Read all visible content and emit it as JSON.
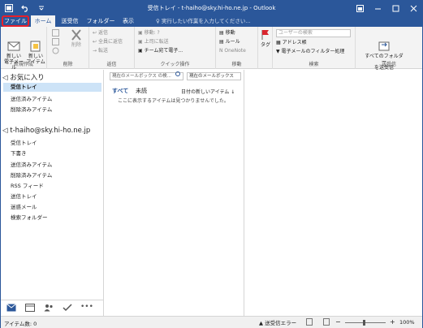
{
  "window": {
    "title": "受信トレイ - t-haiho@sky.hi-ho.ne.jp - Outlook",
    "qat": [
      "outlook-icon",
      "undo-icon",
      "customize-icon"
    ],
    "buttons": [
      "restore-icon",
      "minimize-icon",
      "maximize-icon",
      "close-icon"
    ]
  },
  "tabs": [
    {
      "label": "ファイル"
    },
    {
      "label": "ホーム"
    },
    {
      "label": "送受信"
    },
    {
      "label": "フォルダー"
    },
    {
      "label": "表示"
    }
  ],
  "tell_me": "♀ 実行したい作業を入力してください...",
  "ribbon": {
    "new": {
      "new_email": "新しい\n電子メール",
      "new_items": "新しい\nアイテム",
      "label": "新規作成"
    },
    "delete": {
      "delete": "削除",
      "label": "削除"
    },
    "respond": {
      "reply": "返信",
      "reply_all": "全員に返信",
      "forward": "転送",
      "label": "返信"
    },
    "quick_steps": {
      "move_to": "移動: ?",
      "to_manager": "上司に転送",
      "team_email": "チーム宛て電子...",
      "label": "クイック操作"
    },
    "move": {
      "move": "移動",
      "rules": "ルール",
      "onenote": "OneNote",
      "label": "移動"
    },
    "tags": {
      "tags": "タグ"
    },
    "find": {
      "search_people": "ユーザーの検索",
      "address_book": "アドレス帳",
      "filter_email": "電子メールのフィルター処理",
      "label": "検索"
    },
    "send_receive": {
      "send_all": "すべてのフォルダー\nを送受信",
      "label": "送受信"
    }
  },
  "folders": {
    "favorites_header": "◁ お気に入り",
    "favorites": [
      "受信トレイ",
      "送信済みアイテム",
      "削除済みアイテム"
    ],
    "account_header": "◁ t-haiho@sky.hi-ho.ne.jp",
    "account_items": [
      "受信トレイ",
      "下書き",
      "送信済みアイテム",
      "削除済みアイテム",
      "RSS フィード",
      "送信トレイ",
      "迷惑メール",
      "検索フォルダー"
    ]
  },
  "messages": {
    "search_placeholder": "現在のメールボックス の検...",
    "scope": "現在のメールボックス",
    "filter_all": "すべて",
    "filter_unread": "未読",
    "sort": "日付の新しいアイテム ↓",
    "empty_text": "ここに表示するアイテムは見つかりませんでした。"
  },
  "status": {
    "items": "アイテム数: 0",
    "error": "送受信エラー",
    "zoom": "100%"
  },
  "colors": {
    "accent": "#2b579a",
    "selected": "#cde3f7",
    "file_highlight": "#e8202a"
  }
}
